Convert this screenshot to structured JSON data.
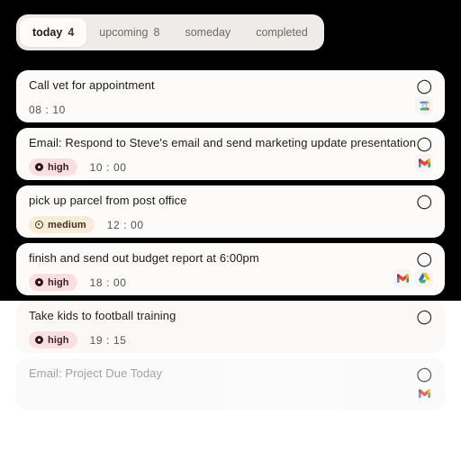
{
  "theme": {
    "page_background": "#000000",
    "lower_background": "#ffffff",
    "card_background": "#fdfbfa",
    "tabbar_background": "#efebe8",
    "active_tab_background": "#fdfcfb",
    "high_badge_background": "#fbdfe0",
    "medium_badge_background": "#f7ecd5"
  },
  "tabs": [
    {
      "label": "today",
      "count": "4",
      "active": true
    },
    {
      "label": "upcoming",
      "count": "8",
      "active": false
    },
    {
      "label": "someday",
      "count": "",
      "active": false
    },
    {
      "label": "completed",
      "count": "",
      "active": false
    }
  ],
  "tasks": [
    {
      "title": "Call vet for appointment",
      "priority": "",
      "priority_label": "",
      "time": "08 : 10",
      "integrations": [
        "google-calendar-icon"
      ],
      "state": "solid"
    },
    {
      "title": "Email: Respond to Steve's email and send marketing update presentation",
      "priority": "high",
      "priority_label": "high",
      "time": "10 : 00",
      "integrations": [
        "gmail-icon"
      ],
      "state": "solid"
    },
    {
      "title": "pick up parcel from post office",
      "priority": "medium",
      "priority_label": "medium",
      "time": "12 : 00",
      "integrations": [],
      "state": "solid"
    },
    {
      "title": "finish and send out budget report at 6:00pm",
      "priority": "high",
      "priority_label": "high",
      "time": "18 : 00",
      "integrations": [
        "gmail-icon",
        "google-drive-icon"
      ],
      "state": "solid"
    },
    {
      "title": "Take kids to football training",
      "priority": "high",
      "priority_label": "high",
      "time": "19 : 15",
      "integrations": [],
      "state": "fade-1"
    },
    {
      "title": "Email: Project Due Today",
      "priority": "",
      "priority_label": "",
      "time": "",
      "integrations": [
        "gmail-icon"
      ],
      "state": "fade-2"
    }
  ]
}
